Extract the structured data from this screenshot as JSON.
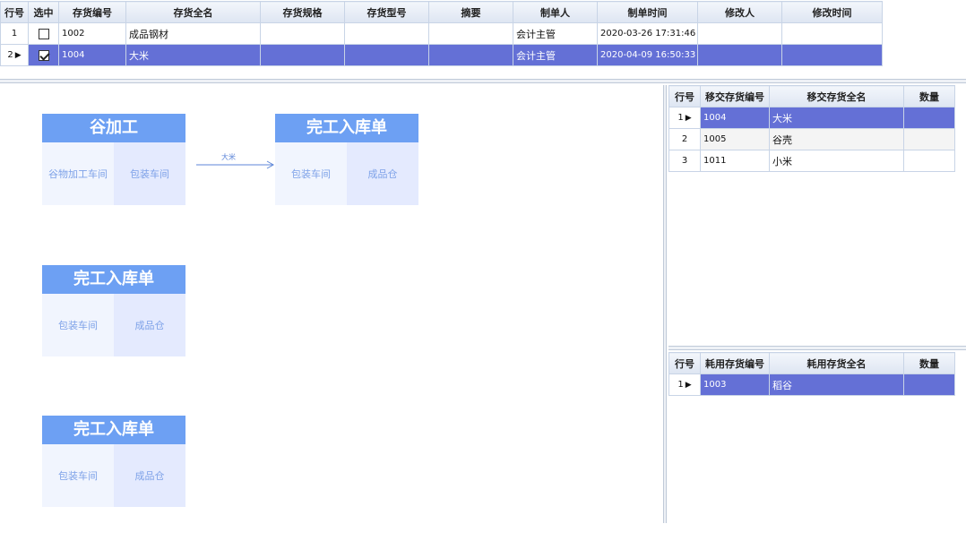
{
  "top_grid": {
    "headers": [
      "行号",
      "选中",
      "存货编号",
      "存货全名",
      "存货规格",
      "存货型号",
      "摘要",
      "制单人",
      "制单时间",
      "修改人",
      "修改时间"
    ],
    "rows": [
      {
        "no": "1",
        "checked": false,
        "code": "1002",
        "name": "成品钢材",
        "spec": "",
        "model": "",
        "summary": "",
        "maker": "会计主管",
        "made_time": "2020-03-26 17:31:46",
        "modifier": "",
        "modified_time": ""
      },
      {
        "no": "2",
        "checked": true,
        "code": "1004",
        "name": "大米",
        "spec": "",
        "model": "",
        "summary": "",
        "maker": "会计主管",
        "made_time": "2020-04-09 16:50:33",
        "modifier": "",
        "modified_time": ""
      }
    ]
  },
  "flow": {
    "cards": [
      {
        "title": "谷加工",
        "left": "谷物加工车间",
        "right": "包装车间"
      },
      {
        "title": "完工入库单",
        "left": "包装车间",
        "right": "成品仓"
      },
      {
        "title": "完工入库单",
        "left": "包装车间",
        "right": "成品仓"
      },
      {
        "title": "完工入库单",
        "left": "包装车间",
        "right": "成品仓"
      }
    ],
    "arrow_label": "大米"
  },
  "transfer_grid": {
    "headers": [
      "行号",
      "移交存货编号",
      "移交存货全名",
      "数量"
    ],
    "rows": [
      {
        "no": "1",
        "code": "1004",
        "name": "大米",
        "qty": ""
      },
      {
        "no": "2",
        "code": "1005",
        "name": "谷壳",
        "qty": ""
      },
      {
        "no": "3",
        "code": "1011",
        "name": "小米",
        "qty": ""
      }
    ]
  },
  "consume_grid": {
    "headers": [
      "行号",
      "耗用存货编号",
      "耗用存货全名",
      "数量"
    ],
    "rows": [
      {
        "no": "1",
        "code": "1003",
        "name": "稻谷",
        "qty": ""
      }
    ]
  },
  "colors": {
    "selection": "#6470d6",
    "card_header": "#6da0f3",
    "card_text": "#7ea2e8"
  }
}
